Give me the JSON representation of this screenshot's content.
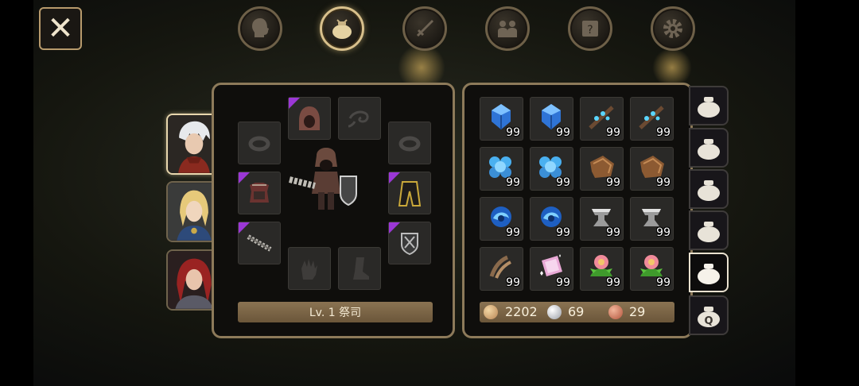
{
  "close_label": "✕",
  "top_tabs": [
    {
      "icon": "head-icon",
      "active": false
    },
    {
      "icon": "bag-icon",
      "active": true
    },
    {
      "icon": "sword-icon",
      "active": false
    },
    {
      "icon": "party-icon",
      "active": false
    },
    {
      "icon": "quest-scroll-icon",
      "active": false
    },
    {
      "icon": "gear-icon",
      "active": false
    }
  ],
  "characters": [
    {
      "name": "white-haired-hero",
      "selected": true
    },
    {
      "name": "blonde-elf",
      "selected": false
    },
    {
      "name": "red-haired-knight",
      "selected": false
    }
  ],
  "equipment": {
    "level_label": "Lv. 1 祭司",
    "slots": [
      {
        "name": "hood",
        "icon": "hood-icon",
        "rare": true
      },
      {
        "name": "cape",
        "icon": "cape-icon",
        "rare": false
      },
      {
        "name": "ring-left",
        "icon": "ring-icon",
        "rare": false
      },
      {
        "name": "ring-right",
        "icon": "ring-icon",
        "rare": false
      },
      {
        "name": "armor",
        "icon": "armor-icon",
        "rare": true
      },
      {
        "name": "skirt",
        "icon": "skirt-icon",
        "rare": true
      },
      {
        "name": "weapon",
        "icon": "flail-icon",
        "rare": true
      },
      {
        "name": "shield",
        "icon": "shield-icon",
        "rare": true
      },
      {
        "name": "gloves",
        "icon": "glove-icon",
        "rare": false
      },
      {
        "name": "boots",
        "icon": "boot-icon",
        "rare": false
      }
    ]
  },
  "inventory": {
    "items": [
      {
        "icon": "blue-gem-icon",
        "qty": "99"
      },
      {
        "icon": "blue-gem-icon",
        "qty": "99"
      },
      {
        "icon": "crystal-branch-icon",
        "qty": "99"
      },
      {
        "icon": "crystal-branch-icon",
        "qty": "99"
      },
      {
        "icon": "blue-orbs-icon",
        "qty": "99"
      },
      {
        "icon": "blue-orbs-icon",
        "qty": "99"
      },
      {
        "icon": "leather-icon",
        "qty": "99"
      },
      {
        "icon": "leather-icon",
        "qty": "99"
      },
      {
        "icon": "blue-swirl-icon",
        "qty": "99"
      },
      {
        "icon": "blue-swirl-icon",
        "qty": "99"
      },
      {
        "icon": "anvil-icon",
        "qty": "99"
      },
      {
        "icon": "anvil-icon",
        "qty": "99"
      },
      {
        "icon": "claw-icon",
        "qty": "99"
      },
      {
        "icon": "sparkle-scroll-icon",
        "qty": "99"
      },
      {
        "icon": "flower-icon",
        "qty": "99"
      },
      {
        "icon": "flower-icon",
        "qty": "99"
      }
    ],
    "currency": {
      "gold": "2202",
      "silver": "69",
      "copper": "29"
    }
  },
  "bag_tabs": [
    {
      "label": "",
      "active": false
    },
    {
      "label": "",
      "active": false
    },
    {
      "label": "",
      "active": false
    },
    {
      "label": "",
      "active": false
    },
    {
      "label": "",
      "active": true
    },
    {
      "label": "Q",
      "active": false
    }
  ],
  "colors": {
    "panel_border": "#8d7a5a",
    "rarity": "#9b37d6",
    "bar": "#7a6446"
  }
}
